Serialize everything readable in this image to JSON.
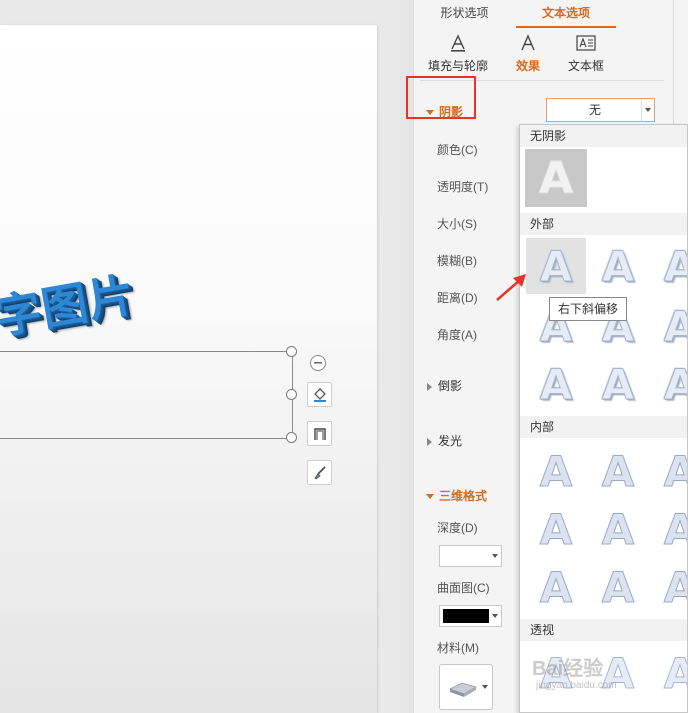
{
  "canvas": {
    "art_text": "字图片"
  },
  "panel": {
    "tabs": [
      {
        "label": "形状选项",
        "active": false
      },
      {
        "label": "文本选项",
        "active": true
      }
    ],
    "subtabs": [
      {
        "label": "填充与轮廓",
        "icon": "text-fill-outline-icon",
        "active": false
      },
      {
        "label": "效果",
        "icon": "text-effects-icon",
        "active": true
      },
      {
        "label": "文本框",
        "icon": "textbox-icon",
        "active": false
      }
    ],
    "shadow": {
      "title": "阴影",
      "value": "无",
      "props": [
        "颜色(C)",
        "透明度(T)",
        "大小(S)",
        "模糊(B)",
        "距离(D)",
        "角度(A)"
      ]
    },
    "reflection": "倒影",
    "glow": "发光",
    "three_d": {
      "title": "三维格式",
      "depth_label": "深度(D)",
      "contour_label": "曲面图(C)",
      "material_label": "材料(M)"
    }
  },
  "gallery": {
    "none_header": "无阴影",
    "outer_header": "外部",
    "inner_header": "内部",
    "perspective_header": "透视",
    "letter": "A",
    "tooltip": "右下斜偏移"
  },
  "watermark": {
    "text": "Bai经验",
    "sub": "jingyan.baidu.com"
  },
  "colors": {
    "accent": "#d86a1f",
    "highlight_box": "#e8332a",
    "art_text": "#2e86d6"
  }
}
